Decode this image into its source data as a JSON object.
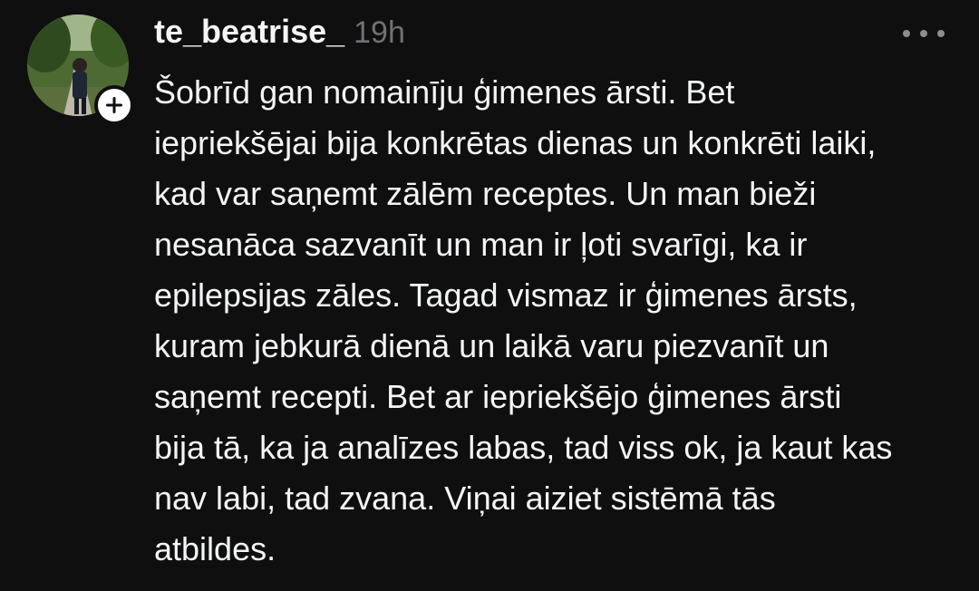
{
  "post": {
    "username": "te_beatrise_",
    "timestamp": "19h",
    "lines": [
      "Šobrīd gan nomainīju ģimenes ārsti. Bet",
      "iepriekšējai bija konkrētas dienas un konkrēti laiki,",
      "kad var saņemt zālēm receptes. Un man bieži",
      "nesanāca sazvanīt un man ir ļoti svarīgi, ka ir",
      "epilepsijas zāles. Tagad vismaz ir ģimenes ārsts,",
      "kuram jebkurā dienā un laikā varu piezvanīt un",
      "saņemt recepti. Bet ar iepriekšējo ģimenes ārsti",
      "bija tā, ka ja analīzes labas, tad viss ok, ja kaut kas",
      "nav labi, tad zvana. Viņai aiziet sistēmā tās",
      "atbildes."
    ]
  },
  "icons": {
    "avatar": "profile-photo",
    "follow": "plus-icon",
    "more": "more-horizontal-icon"
  },
  "colors": {
    "background": "#0f0f0f",
    "text": "#f3f5f7",
    "muted": "#6f7276"
  }
}
